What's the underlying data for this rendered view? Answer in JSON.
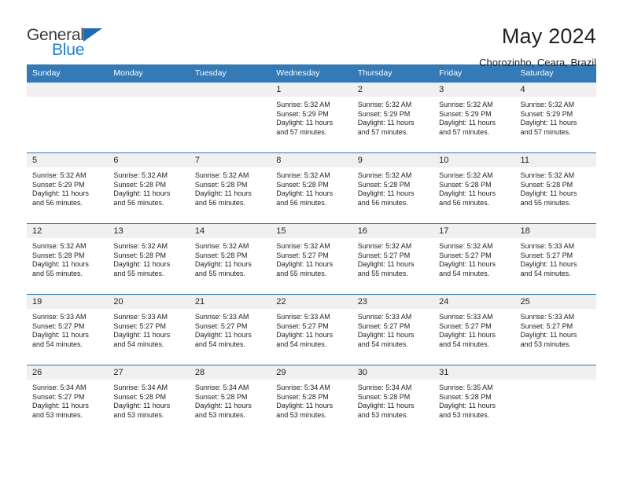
{
  "logo": {
    "part1": "General",
    "part2": "Blue",
    "triangle_color": "#1d6cb3",
    "blue_color": "#1b7fd4"
  },
  "header": {
    "title": "May 2024",
    "subtitle": "Chorozinho, Ceara, Brazil"
  },
  "theme": {
    "header_bg": "#337ab7",
    "daynum_bg": "#f0f0f0",
    "row_border": "#2f74b0"
  },
  "weekday_headers": [
    "Sunday",
    "Monday",
    "Tuesday",
    "Wednesday",
    "Thursday",
    "Friday",
    "Saturday"
  ],
  "weeks": [
    [
      {
        "day": ""
      },
      {
        "day": ""
      },
      {
        "day": ""
      },
      {
        "day": "1",
        "sunrise": "Sunrise: 5:32 AM",
        "sunset": "Sunset: 5:29 PM",
        "daylight1": "Daylight: 11 hours",
        "daylight2": "and 57 minutes."
      },
      {
        "day": "2",
        "sunrise": "Sunrise: 5:32 AM",
        "sunset": "Sunset: 5:29 PM",
        "daylight1": "Daylight: 11 hours",
        "daylight2": "and 57 minutes."
      },
      {
        "day": "3",
        "sunrise": "Sunrise: 5:32 AM",
        "sunset": "Sunset: 5:29 PM",
        "daylight1": "Daylight: 11 hours",
        "daylight2": "and 57 minutes."
      },
      {
        "day": "4",
        "sunrise": "Sunrise: 5:32 AM",
        "sunset": "Sunset: 5:29 PM",
        "daylight1": "Daylight: 11 hours",
        "daylight2": "and 57 minutes."
      }
    ],
    [
      {
        "day": "5",
        "sunrise": "Sunrise: 5:32 AM",
        "sunset": "Sunset: 5:29 PM",
        "daylight1": "Daylight: 11 hours",
        "daylight2": "and 56 minutes."
      },
      {
        "day": "6",
        "sunrise": "Sunrise: 5:32 AM",
        "sunset": "Sunset: 5:28 PM",
        "daylight1": "Daylight: 11 hours",
        "daylight2": "and 56 minutes."
      },
      {
        "day": "7",
        "sunrise": "Sunrise: 5:32 AM",
        "sunset": "Sunset: 5:28 PM",
        "daylight1": "Daylight: 11 hours",
        "daylight2": "and 56 minutes."
      },
      {
        "day": "8",
        "sunrise": "Sunrise: 5:32 AM",
        "sunset": "Sunset: 5:28 PM",
        "daylight1": "Daylight: 11 hours",
        "daylight2": "and 56 minutes."
      },
      {
        "day": "9",
        "sunrise": "Sunrise: 5:32 AM",
        "sunset": "Sunset: 5:28 PM",
        "daylight1": "Daylight: 11 hours",
        "daylight2": "and 56 minutes."
      },
      {
        "day": "10",
        "sunrise": "Sunrise: 5:32 AM",
        "sunset": "Sunset: 5:28 PM",
        "daylight1": "Daylight: 11 hours",
        "daylight2": "and 56 minutes."
      },
      {
        "day": "11",
        "sunrise": "Sunrise: 5:32 AM",
        "sunset": "Sunset: 5:28 PM",
        "daylight1": "Daylight: 11 hours",
        "daylight2": "and 55 minutes."
      }
    ],
    [
      {
        "day": "12",
        "sunrise": "Sunrise: 5:32 AM",
        "sunset": "Sunset: 5:28 PM",
        "daylight1": "Daylight: 11 hours",
        "daylight2": "and 55 minutes."
      },
      {
        "day": "13",
        "sunrise": "Sunrise: 5:32 AM",
        "sunset": "Sunset: 5:28 PM",
        "daylight1": "Daylight: 11 hours",
        "daylight2": "and 55 minutes."
      },
      {
        "day": "14",
        "sunrise": "Sunrise: 5:32 AM",
        "sunset": "Sunset: 5:28 PM",
        "daylight1": "Daylight: 11 hours",
        "daylight2": "and 55 minutes."
      },
      {
        "day": "15",
        "sunrise": "Sunrise: 5:32 AM",
        "sunset": "Sunset: 5:27 PM",
        "daylight1": "Daylight: 11 hours",
        "daylight2": "and 55 minutes."
      },
      {
        "day": "16",
        "sunrise": "Sunrise: 5:32 AM",
        "sunset": "Sunset: 5:27 PM",
        "daylight1": "Daylight: 11 hours",
        "daylight2": "and 55 minutes."
      },
      {
        "day": "17",
        "sunrise": "Sunrise: 5:32 AM",
        "sunset": "Sunset: 5:27 PM",
        "daylight1": "Daylight: 11 hours",
        "daylight2": "and 54 minutes."
      },
      {
        "day": "18",
        "sunrise": "Sunrise: 5:33 AM",
        "sunset": "Sunset: 5:27 PM",
        "daylight1": "Daylight: 11 hours",
        "daylight2": "and 54 minutes."
      }
    ],
    [
      {
        "day": "19",
        "sunrise": "Sunrise: 5:33 AM",
        "sunset": "Sunset: 5:27 PM",
        "daylight1": "Daylight: 11 hours",
        "daylight2": "and 54 minutes."
      },
      {
        "day": "20",
        "sunrise": "Sunrise: 5:33 AM",
        "sunset": "Sunset: 5:27 PM",
        "daylight1": "Daylight: 11 hours",
        "daylight2": "and 54 minutes."
      },
      {
        "day": "21",
        "sunrise": "Sunrise: 5:33 AM",
        "sunset": "Sunset: 5:27 PM",
        "daylight1": "Daylight: 11 hours",
        "daylight2": "and 54 minutes."
      },
      {
        "day": "22",
        "sunrise": "Sunrise: 5:33 AM",
        "sunset": "Sunset: 5:27 PM",
        "daylight1": "Daylight: 11 hours",
        "daylight2": "and 54 minutes."
      },
      {
        "day": "23",
        "sunrise": "Sunrise: 5:33 AM",
        "sunset": "Sunset: 5:27 PM",
        "daylight1": "Daylight: 11 hours",
        "daylight2": "and 54 minutes."
      },
      {
        "day": "24",
        "sunrise": "Sunrise: 5:33 AM",
        "sunset": "Sunset: 5:27 PM",
        "daylight1": "Daylight: 11 hours",
        "daylight2": "and 54 minutes."
      },
      {
        "day": "25",
        "sunrise": "Sunrise: 5:33 AM",
        "sunset": "Sunset: 5:27 PM",
        "daylight1": "Daylight: 11 hours",
        "daylight2": "and 53 minutes."
      }
    ],
    [
      {
        "day": "26",
        "sunrise": "Sunrise: 5:34 AM",
        "sunset": "Sunset: 5:27 PM",
        "daylight1": "Daylight: 11 hours",
        "daylight2": "and 53 minutes."
      },
      {
        "day": "27",
        "sunrise": "Sunrise: 5:34 AM",
        "sunset": "Sunset: 5:28 PM",
        "daylight1": "Daylight: 11 hours",
        "daylight2": "and 53 minutes."
      },
      {
        "day": "28",
        "sunrise": "Sunrise: 5:34 AM",
        "sunset": "Sunset: 5:28 PM",
        "daylight1": "Daylight: 11 hours",
        "daylight2": "and 53 minutes."
      },
      {
        "day": "29",
        "sunrise": "Sunrise: 5:34 AM",
        "sunset": "Sunset: 5:28 PM",
        "daylight1": "Daylight: 11 hours",
        "daylight2": "and 53 minutes."
      },
      {
        "day": "30",
        "sunrise": "Sunrise: 5:34 AM",
        "sunset": "Sunset: 5:28 PM",
        "daylight1": "Daylight: 11 hours",
        "daylight2": "and 53 minutes."
      },
      {
        "day": "31",
        "sunrise": "Sunrise: 5:35 AM",
        "sunset": "Sunset: 5:28 PM",
        "daylight1": "Daylight: 11 hours",
        "daylight2": "and 53 minutes."
      },
      {
        "day": ""
      }
    ]
  ]
}
